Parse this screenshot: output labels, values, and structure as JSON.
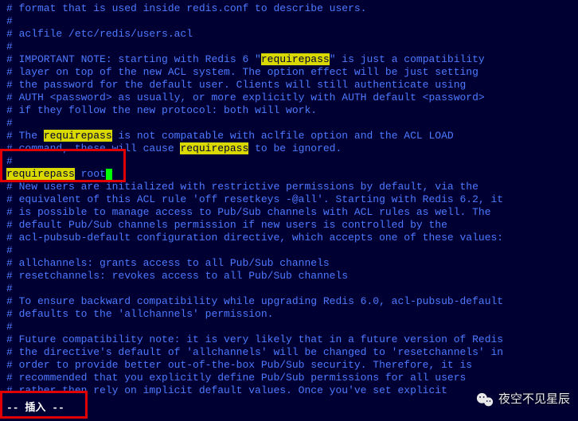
{
  "lines": [
    {
      "pre": "# format that is used inside redis.conf to describe users."
    },
    {
      "pre": "#"
    },
    {
      "pre": "# aclfile /etc/redis/users.acl"
    },
    {
      "pre": "#"
    },
    {
      "pre": "# IMPORTANT NOTE: starting with Redis 6 \"",
      "hl": "requirepass",
      "post": "\" is just a compatibility"
    },
    {
      "pre": "# layer on top of the new ACL system. The option effect will be just setting"
    },
    {
      "pre": "# the password for the default user. Clients will still authenticate using"
    },
    {
      "pre": "# AUTH <password> as usually, or more explicitly with AUTH default <password>"
    },
    {
      "pre": "# if they follow the new protocol: both will work."
    },
    {
      "pre": "#"
    },
    {
      "pre": "# The ",
      "hl": "requirepass",
      "post": " is not compatable with aclfile option and the ACL LOAD"
    },
    {
      "pre": "# command, these will cause ",
      "hl": "requirepass",
      "post": " to be ignored."
    },
    {
      "pre": "#"
    },
    {
      "pre": "",
      "hl": "requirepass",
      "post": " root",
      "cursor": true
    },
    {
      "pre": ""
    },
    {
      "pre": "# New users are initialized with restrictive permissions by default, via the"
    },
    {
      "pre": "# equivalent of this ACL rule 'off resetkeys -@all'. Starting with Redis 6.2, it"
    },
    {
      "pre": "# is possible to manage access to Pub/Sub channels with ACL rules as well. The"
    },
    {
      "pre": "# default Pub/Sub channels permission if new users is controlled by the"
    },
    {
      "pre": "# acl-pubsub-default configuration directive, which accepts one of these values:"
    },
    {
      "pre": "#"
    },
    {
      "pre": "# allchannels: grants access to all Pub/Sub channels"
    },
    {
      "pre": "# resetchannels: revokes access to all Pub/Sub channels"
    },
    {
      "pre": "#"
    },
    {
      "pre": "# To ensure backward compatibility while upgrading Redis 6.0, acl-pubsub-default"
    },
    {
      "pre": "# defaults to the 'allchannels' permission."
    },
    {
      "pre": "#"
    },
    {
      "pre": "# Future compatibility note: it is very likely that in a future version of Redis"
    },
    {
      "pre": "# the directive's default of 'allchannels' will be changed to 'resetchannels' in"
    },
    {
      "pre": "# order to provide better out-of-the-box Pub/Sub security. Therefore, it is"
    },
    {
      "pre": "# recommended that you explicitly define Pub/Sub permissions for all users"
    },
    {
      "pre": "# rather then rely on implicit default values. Once you've set explicit"
    }
  ],
  "mode": "-- 插入 --",
  "watermark": "夜空不见星辰"
}
